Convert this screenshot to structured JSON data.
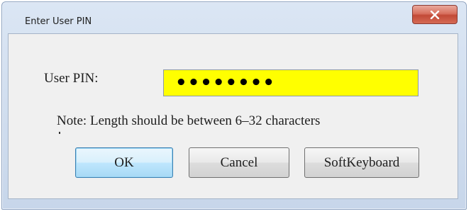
{
  "window": {
    "title": "Enter User PIN",
    "close_icon": "close-x-icon"
  },
  "form": {
    "pin_label": "User PIN:",
    "pin_value": "••••••••",
    "pin_field_background": "#ffff00",
    "note": "Note: Length should be between 6–32 characters"
  },
  "buttons": {
    "ok_label": "OK",
    "cancel_label": "Cancel",
    "softkeyboard_label": "SoftKeyboard"
  }
}
